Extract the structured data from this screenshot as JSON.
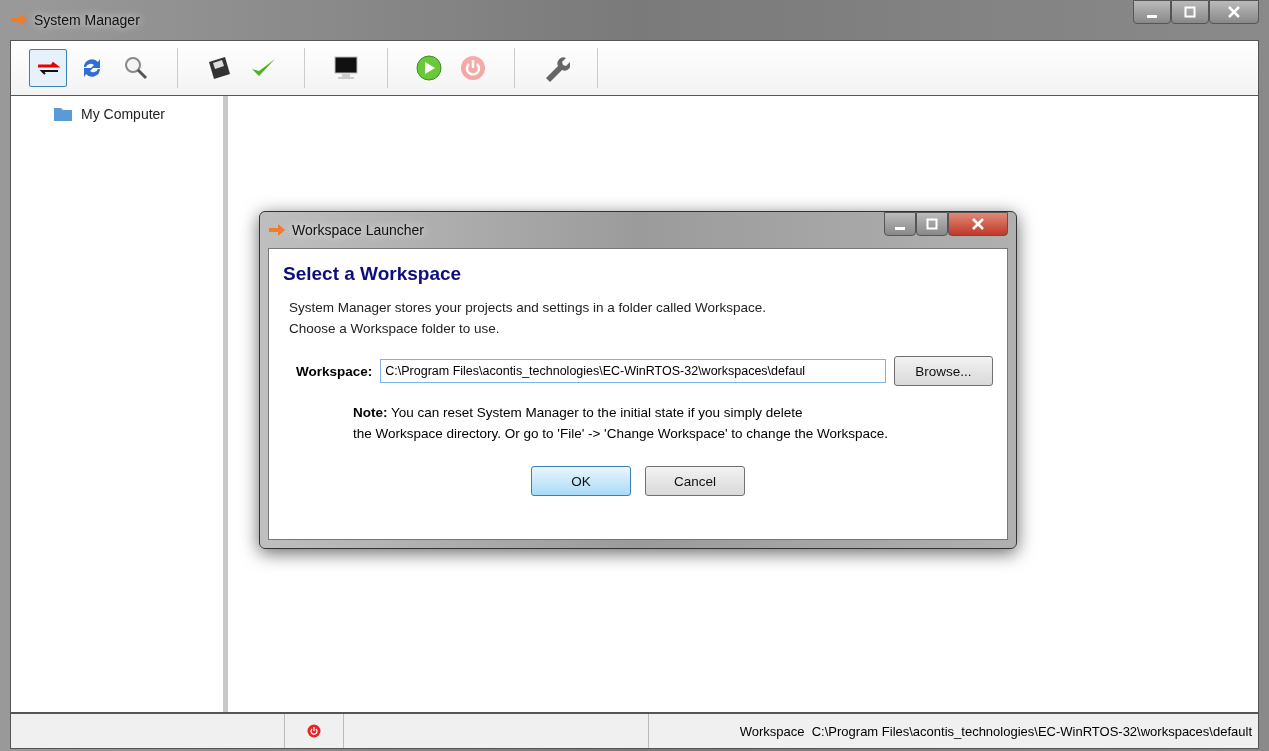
{
  "window": {
    "title": "System Manager"
  },
  "toolbar": {
    "groups": [
      [
        {
          "kind": "connect",
          "selected": true,
          "disabled": false
        },
        {
          "kind": "refresh",
          "selected": false,
          "disabled": false
        },
        {
          "kind": "search",
          "selected": false,
          "disabled": false
        }
      ],
      [
        {
          "kind": "save",
          "selected": false,
          "disabled": false
        },
        {
          "kind": "check",
          "selected": false,
          "disabled": false
        }
      ],
      [
        {
          "kind": "terminal",
          "selected": false,
          "disabled": false
        }
      ],
      [
        {
          "kind": "play",
          "selected": false,
          "disabled": false
        },
        {
          "kind": "power",
          "selected": false,
          "disabled": true
        }
      ],
      [
        {
          "kind": "wrench",
          "selected": false,
          "disabled": false
        }
      ]
    ]
  },
  "tree": {
    "items": [
      {
        "label": "My Computer"
      }
    ]
  },
  "dialog": {
    "title": "Workspace Launcher",
    "heading": "Select a Workspace",
    "intro": [
      "System Manager stores your projects and settings in a folder called Workspace.",
      "Choose a Workspace folder to use."
    ],
    "field_label": "Workspace:",
    "field_value": "C:\\Program Files\\acontis_technologies\\EC-WinRTOS-32\\workspaces\\defaul",
    "browse": "Browse...",
    "note": [
      "**Note:** You can reset System Manager to the initial state if you simply delete",
      "the Workspace directory. Or go to 'File' -> 'Change Workspace' to change the Workspace."
    ],
    "buttons": [
      {
        "label": "OK",
        "default": true
      },
      {
        "label": "Cancel",
        "default": false
      }
    ]
  },
  "status_bar": {
    "label": "Workspace",
    "path": "C:\\Program Files\\acontis_technologies\\EC-WinRTOS-32\\workspaces\\default"
  }
}
